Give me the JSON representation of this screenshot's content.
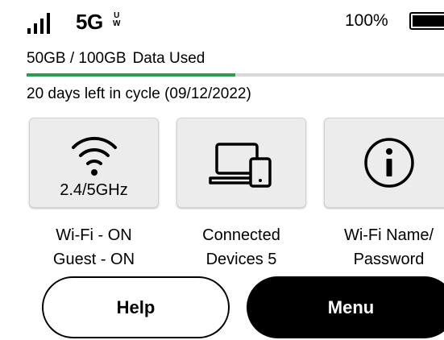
{
  "status": {
    "network": "5G",
    "network_badge_top": "U",
    "network_badge_bottom": "W",
    "battery_text": "100%",
    "battery_level": 1.0
  },
  "usage": {
    "amount": "50GB / 100GB",
    "label": "Data Used",
    "fraction": 0.5,
    "bar_color": "#2e9b4e",
    "cycle_text": "20  days left in cycle (09/12/2022)"
  },
  "tiles": [
    {
      "icon": "wifi-icon",
      "sub": "2.4/5GHz",
      "caption_line1": "Wi-Fi - ON",
      "caption_line2": "Guest - ON"
    },
    {
      "icon": "connected-devices-icon",
      "caption_line1": "Connected",
      "caption_line2": "Devices 5"
    },
    {
      "icon": "info-icon",
      "caption_line1": "Wi-Fi Name/",
      "caption_line2": "Password"
    }
  ],
  "buttons": {
    "help": "Help",
    "menu": "Menu"
  }
}
